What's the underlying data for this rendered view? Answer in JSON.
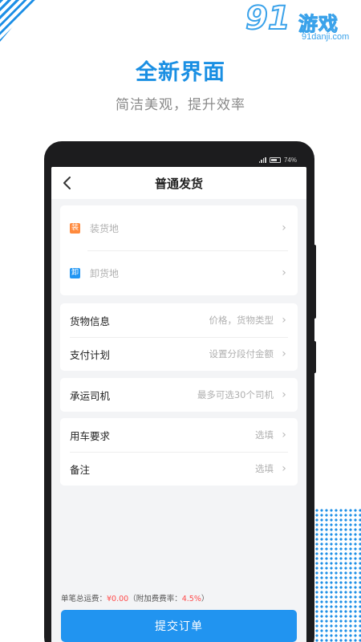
{
  "logo": {
    "numeral": "91",
    "name": "游戏",
    "url": "91danji.com"
  },
  "promo": {
    "headline": "全新界面",
    "subline": "简洁美观，提升效率"
  },
  "status_bar": {
    "battery": "74%"
  },
  "header": {
    "back_icon": "chevron-left-icon",
    "title": "普通发货"
  },
  "addresses": [
    {
      "tag": "装",
      "placeholder": "装货地",
      "tag_color": "#ff8a3d"
    },
    {
      "tag": "卸",
      "placeholder": "卸货地",
      "tag_color": "#2196f3"
    }
  ],
  "cargo": {
    "goods_label": "货物信息",
    "goods_hint": "价格，货物类型",
    "payment_label": "支付计划",
    "payment_hint": "设置分段付金额"
  },
  "driver": {
    "label": "承运司机",
    "hint": "最多可选30个司机"
  },
  "extras": {
    "vehicle_label": "用车要求",
    "vehicle_hint": "选填",
    "note_label": "备注",
    "note_hint": "选填"
  },
  "footer": {
    "fee_prefix": "单笔总运费：",
    "fee_value": "¥0.00",
    "rate_prefix": "（附加费费率：",
    "rate_value": "4.5%",
    "rate_suffix": "）",
    "submit_label": "提交订单"
  },
  "colors": {
    "accent": "#2194f0",
    "headline": "#1a8fe3",
    "price": "#ff4b4b"
  }
}
